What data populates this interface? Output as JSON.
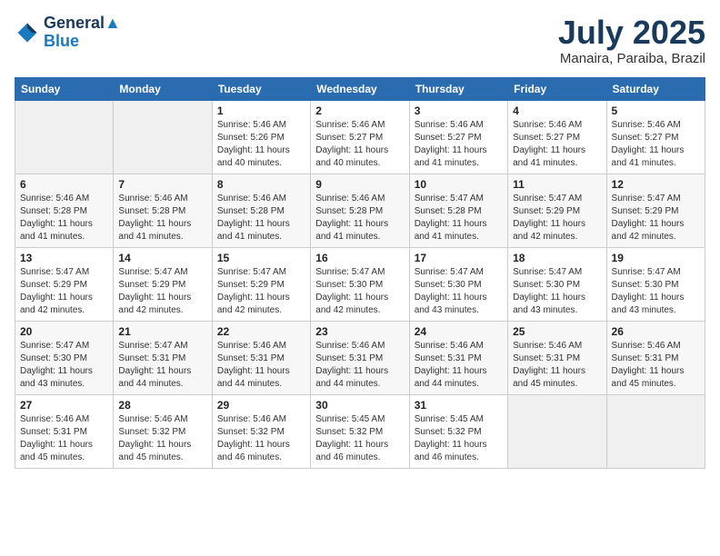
{
  "header": {
    "logo_line1": "General",
    "logo_line2": "Blue",
    "month_year": "July 2025",
    "location": "Manaira, Paraiba, Brazil"
  },
  "days_of_week": [
    "Sunday",
    "Monday",
    "Tuesday",
    "Wednesday",
    "Thursday",
    "Friday",
    "Saturday"
  ],
  "weeks": [
    [
      {
        "day": "",
        "info": ""
      },
      {
        "day": "",
        "info": ""
      },
      {
        "day": "1",
        "info": "Sunrise: 5:46 AM\nSunset: 5:26 PM\nDaylight: 11 hours and 40 minutes."
      },
      {
        "day": "2",
        "info": "Sunrise: 5:46 AM\nSunset: 5:27 PM\nDaylight: 11 hours and 40 minutes."
      },
      {
        "day": "3",
        "info": "Sunrise: 5:46 AM\nSunset: 5:27 PM\nDaylight: 11 hours and 41 minutes."
      },
      {
        "day": "4",
        "info": "Sunrise: 5:46 AM\nSunset: 5:27 PM\nDaylight: 11 hours and 41 minutes."
      },
      {
        "day": "5",
        "info": "Sunrise: 5:46 AM\nSunset: 5:27 PM\nDaylight: 11 hours and 41 minutes."
      }
    ],
    [
      {
        "day": "6",
        "info": "Sunrise: 5:46 AM\nSunset: 5:28 PM\nDaylight: 11 hours and 41 minutes."
      },
      {
        "day": "7",
        "info": "Sunrise: 5:46 AM\nSunset: 5:28 PM\nDaylight: 11 hours and 41 minutes."
      },
      {
        "day": "8",
        "info": "Sunrise: 5:46 AM\nSunset: 5:28 PM\nDaylight: 11 hours and 41 minutes."
      },
      {
        "day": "9",
        "info": "Sunrise: 5:46 AM\nSunset: 5:28 PM\nDaylight: 11 hours and 41 minutes."
      },
      {
        "day": "10",
        "info": "Sunrise: 5:47 AM\nSunset: 5:28 PM\nDaylight: 11 hours and 41 minutes."
      },
      {
        "day": "11",
        "info": "Sunrise: 5:47 AM\nSunset: 5:29 PM\nDaylight: 11 hours and 42 minutes."
      },
      {
        "day": "12",
        "info": "Sunrise: 5:47 AM\nSunset: 5:29 PM\nDaylight: 11 hours and 42 minutes."
      }
    ],
    [
      {
        "day": "13",
        "info": "Sunrise: 5:47 AM\nSunset: 5:29 PM\nDaylight: 11 hours and 42 minutes."
      },
      {
        "day": "14",
        "info": "Sunrise: 5:47 AM\nSunset: 5:29 PM\nDaylight: 11 hours and 42 minutes."
      },
      {
        "day": "15",
        "info": "Sunrise: 5:47 AM\nSunset: 5:29 PM\nDaylight: 11 hours and 42 minutes."
      },
      {
        "day": "16",
        "info": "Sunrise: 5:47 AM\nSunset: 5:30 PM\nDaylight: 11 hours and 42 minutes."
      },
      {
        "day": "17",
        "info": "Sunrise: 5:47 AM\nSunset: 5:30 PM\nDaylight: 11 hours and 43 minutes."
      },
      {
        "day": "18",
        "info": "Sunrise: 5:47 AM\nSunset: 5:30 PM\nDaylight: 11 hours and 43 minutes."
      },
      {
        "day": "19",
        "info": "Sunrise: 5:47 AM\nSunset: 5:30 PM\nDaylight: 11 hours and 43 minutes."
      }
    ],
    [
      {
        "day": "20",
        "info": "Sunrise: 5:47 AM\nSunset: 5:30 PM\nDaylight: 11 hours and 43 minutes."
      },
      {
        "day": "21",
        "info": "Sunrise: 5:47 AM\nSunset: 5:31 PM\nDaylight: 11 hours and 44 minutes."
      },
      {
        "day": "22",
        "info": "Sunrise: 5:46 AM\nSunset: 5:31 PM\nDaylight: 11 hours and 44 minutes."
      },
      {
        "day": "23",
        "info": "Sunrise: 5:46 AM\nSunset: 5:31 PM\nDaylight: 11 hours and 44 minutes."
      },
      {
        "day": "24",
        "info": "Sunrise: 5:46 AM\nSunset: 5:31 PM\nDaylight: 11 hours and 44 minutes."
      },
      {
        "day": "25",
        "info": "Sunrise: 5:46 AM\nSunset: 5:31 PM\nDaylight: 11 hours and 45 minutes."
      },
      {
        "day": "26",
        "info": "Sunrise: 5:46 AM\nSunset: 5:31 PM\nDaylight: 11 hours and 45 minutes."
      }
    ],
    [
      {
        "day": "27",
        "info": "Sunrise: 5:46 AM\nSunset: 5:31 PM\nDaylight: 11 hours and 45 minutes."
      },
      {
        "day": "28",
        "info": "Sunrise: 5:46 AM\nSunset: 5:32 PM\nDaylight: 11 hours and 45 minutes."
      },
      {
        "day": "29",
        "info": "Sunrise: 5:46 AM\nSunset: 5:32 PM\nDaylight: 11 hours and 46 minutes."
      },
      {
        "day": "30",
        "info": "Sunrise: 5:45 AM\nSunset: 5:32 PM\nDaylight: 11 hours and 46 minutes."
      },
      {
        "day": "31",
        "info": "Sunrise: 5:45 AM\nSunset: 5:32 PM\nDaylight: 11 hours and 46 minutes."
      },
      {
        "day": "",
        "info": ""
      },
      {
        "day": "",
        "info": ""
      }
    ]
  ]
}
